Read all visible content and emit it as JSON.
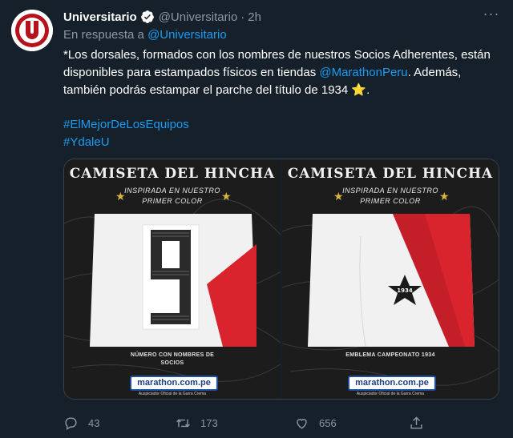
{
  "tweet": {
    "author_name": "Universitario",
    "author_handle": "@Universitario",
    "separator": "·",
    "time": "2h",
    "more_label": "···",
    "reply_prefix": "En respuesta a",
    "reply_to": "@Universitario",
    "text_part1": "*Los dorsales, formados con los nombres de nuestros Socios Adherentes, están disponibles para estampados físicos en tiendas ",
    "text_mention": "@MarathonPeru",
    "text_part2": ". Además, también podrás estampar el parche del título de 1934 ",
    "text_emoji": "⭐",
    "text_part3": ".",
    "hashtags": [
      "#ElMejorDeLosEquipos",
      "#YdaleU"
    ]
  },
  "avatar": {
    "letter": "U",
    "colors": {
      "ring": "#b5121b",
      "bg": "#ffffff"
    }
  },
  "media": {
    "panels": [
      {
        "title": "CAMISETA DEL HINCHA",
        "subtitle_1": "INSPIRADA EN NUESTRO",
        "subtitle_2": "PRIMER COLOR",
        "number": "9",
        "caption_line1": "NÚMERO CON NOMBRES DE",
        "caption_line2": "SOCIOS",
        "shop": "marathon.com.pe",
        "shop_sub": "Auspiciador Oficial de la Garra Crema"
      },
      {
        "title": "CAMISETA DEL HINCHA",
        "subtitle_1": "INSPIRADA EN NUESTRO",
        "subtitle_2": "PRIMER COLOR",
        "badge": "1934",
        "caption_line1": "EMBLEMA CAMPEONATO 1934",
        "caption_line2": "",
        "shop": "marathon.com.pe",
        "shop_sub": "Auspiciador Oficial de la Garra Crema"
      }
    ]
  },
  "actions": {
    "replies": "43",
    "retweets": "173",
    "likes": "656"
  },
  "colors": {
    "background": "#15202b",
    "link": "#1d9bf0",
    "muted": "#8b98a5",
    "jersey_red": "#d9232d"
  },
  "icons": [
    "verified-badge-icon",
    "more-options-icon",
    "reply-icon",
    "retweet-icon",
    "like-icon",
    "share-icon"
  ]
}
